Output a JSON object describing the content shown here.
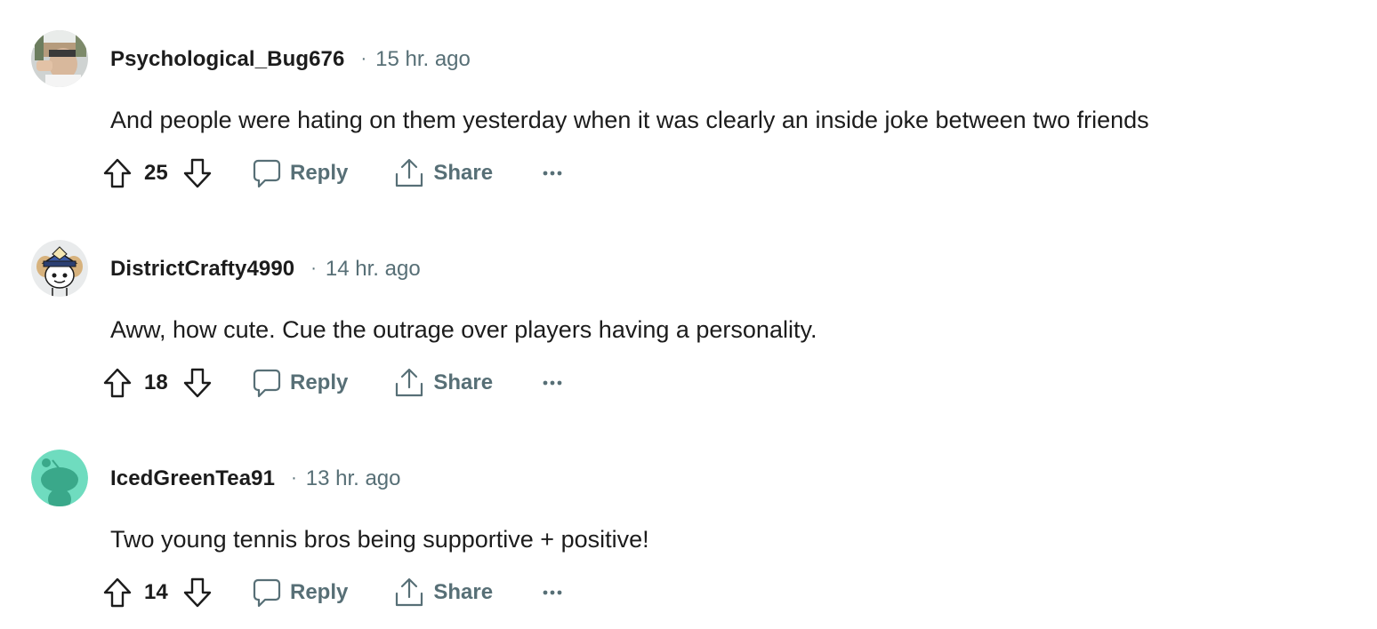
{
  "comments": [
    {
      "username": "Psychological_Bug676",
      "separator": "·",
      "time": "15 hr. ago",
      "body": "And people were hating on them yesterday when it was clearly an inside joke between two friends",
      "score": "25",
      "reply_label": "Reply",
      "share_label": "Share",
      "avatar": "photo-avatar"
    },
    {
      "username": "DistrictCrafty4990",
      "separator": "·",
      "time": "14 hr. ago",
      "body": "Aww, how cute. Cue the outrage over players having a personality.",
      "score": "18",
      "reply_label": "Reply",
      "share_label": "Share",
      "avatar": "snoo-captain-hat-avatar"
    },
    {
      "username": "IcedGreenTea91",
      "separator": "·",
      "time": "13 hr. ago",
      "body": "Two young tennis bros being supportive + positive!",
      "score": "14",
      "reply_label": "Reply",
      "share_label": "Share",
      "avatar": "snoo-default-green-avatar"
    }
  ],
  "icons": {
    "upvote": "upvote-arrow-icon",
    "downvote": "downvote-arrow-icon",
    "reply": "speech-bubble-icon",
    "share": "share-upload-icon",
    "more": "ellipsis-icon"
  },
  "colors": {
    "text": "#1c1c1c",
    "meta": "#576f76",
    "avatar_green": "#6fdcbf"
  }
}
